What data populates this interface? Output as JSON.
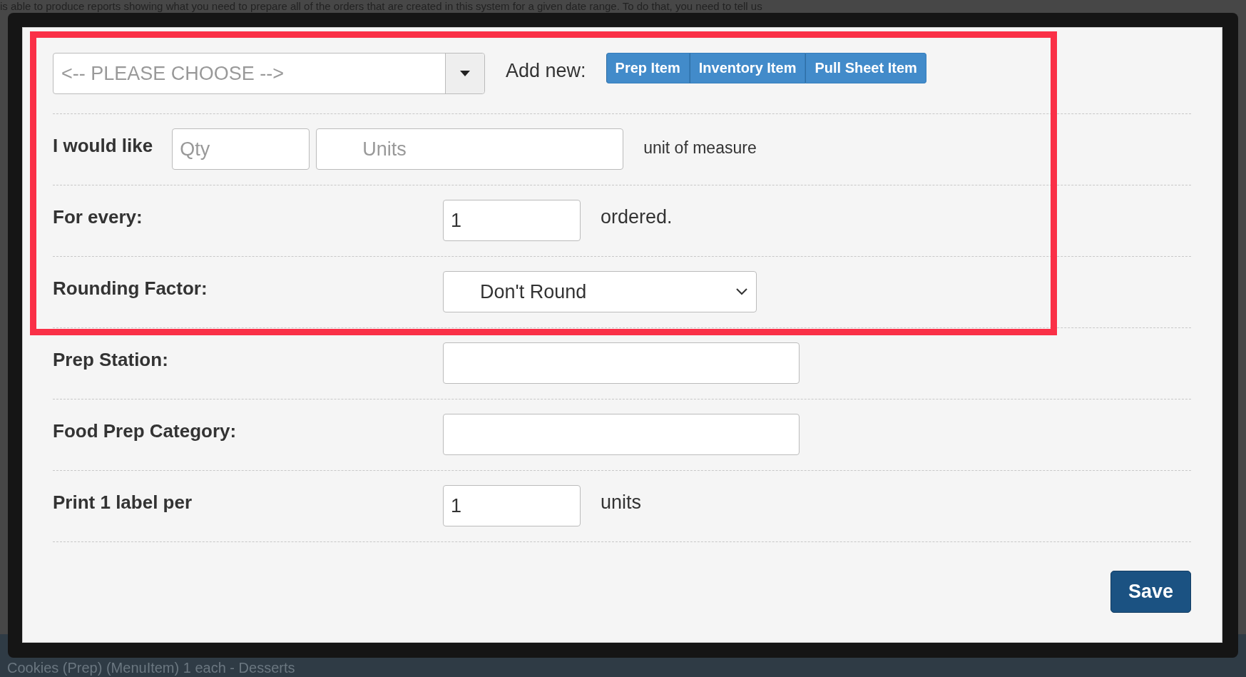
{
  "background": {
    "top_text": "is able to produce reports showing what you need to prepare all of the orders that are created in this system for a given date range. To do that, you need to tell us",
    "bottom_text": "Cookies (Prep) (MenuItem) 1 each - Desserts"
  },
  "item_select": {
    "placeholder": "<-- PLEASE CHOOSE -->"
  },
  "add_new": {
    "label": "Add new:",
    "buttons": [
      "Prep Item",
      "Inventory Item",
      "Pull Sheet Item"
    ]
  },
  "rows": [
    {
      "kind": "qty_units",
      "label": "I would like",
      "qty_placeholder": "Qty",
      "units_placeholder": "Units",
      "suffix": "unit of measure"
    },
    {
      "kind": "number",
      "label": "For every:",
      "value": "1",
      "suffix": "ordered."
    },
    {
      "kind": "select",
      "label": "Rounding Factor:",
      "value": "Don't Round"
    },
    {
      "kind": "text",
      "label": "Prep Station:"
    },
    {
      "kind": "text",
      "label": "Food Prep Category:"
    },
    {
      "kind": "number",
      "label": "Print 1 label per",
      "value": "1",
      "suffix": "units"
    }
  ],
  "save_button": "Save"
}
